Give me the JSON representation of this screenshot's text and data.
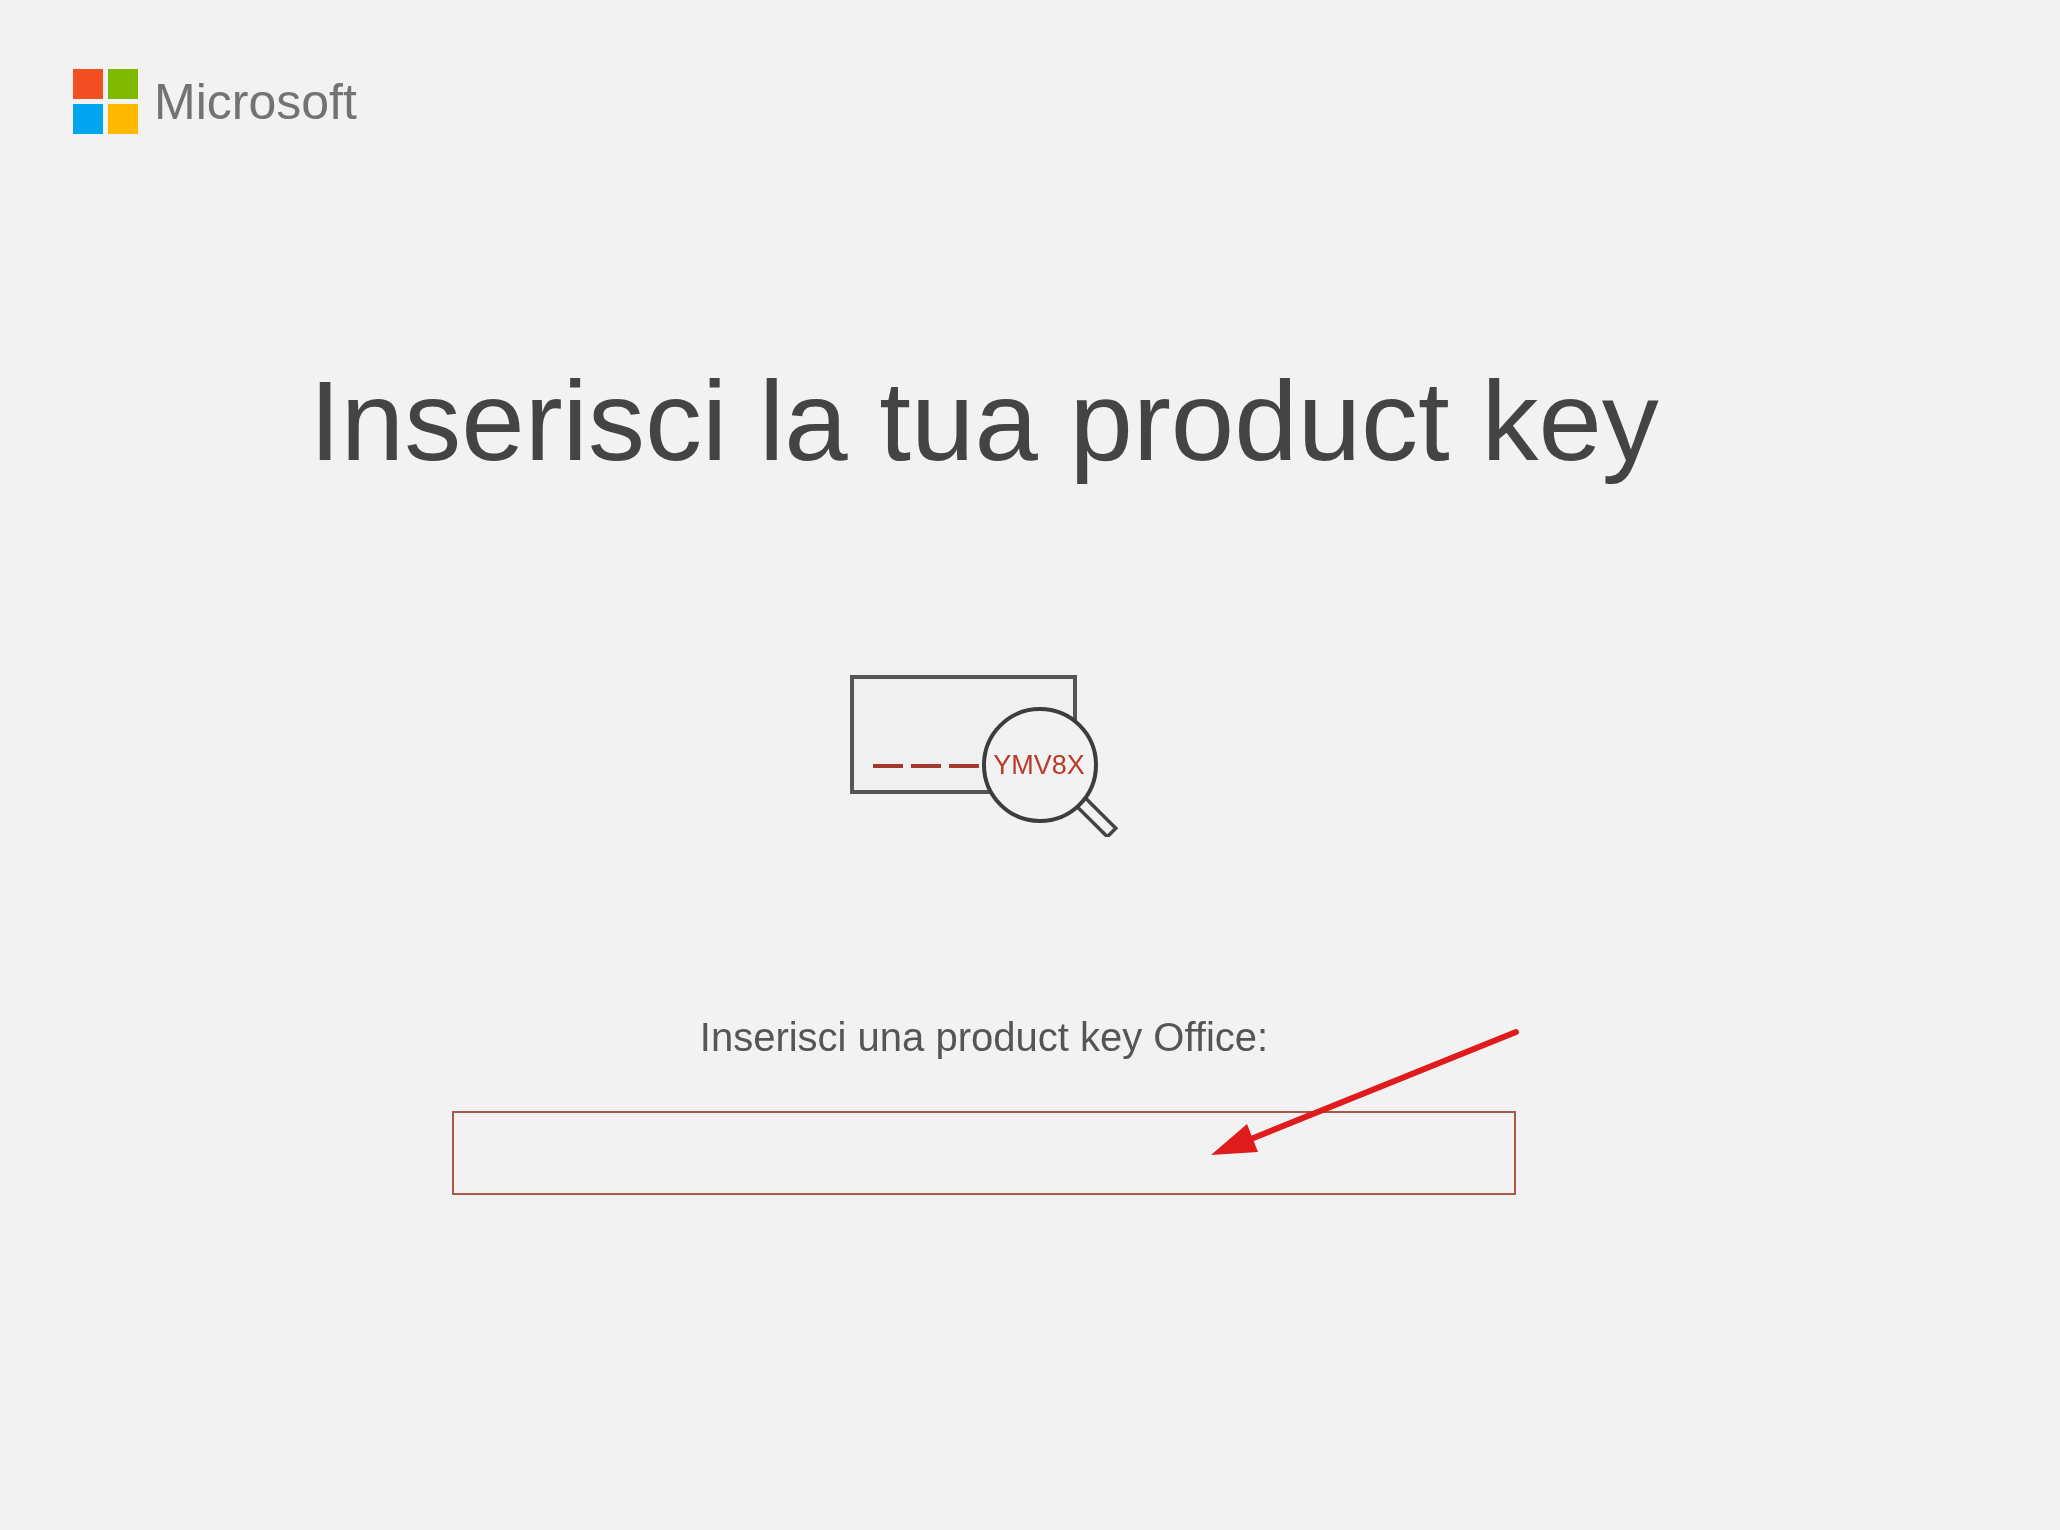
{
  "header": {
    "brand": "Microsoft"
  },
  "title": "Inserisci la tua product key",
  "illustration": {
    "key_text": "YMV8X"
  },
  "product_key": {
    "label": "Inserisci una product key Office:",
    "annotation": {
      "kind": "arrow"
    }
  }
}
